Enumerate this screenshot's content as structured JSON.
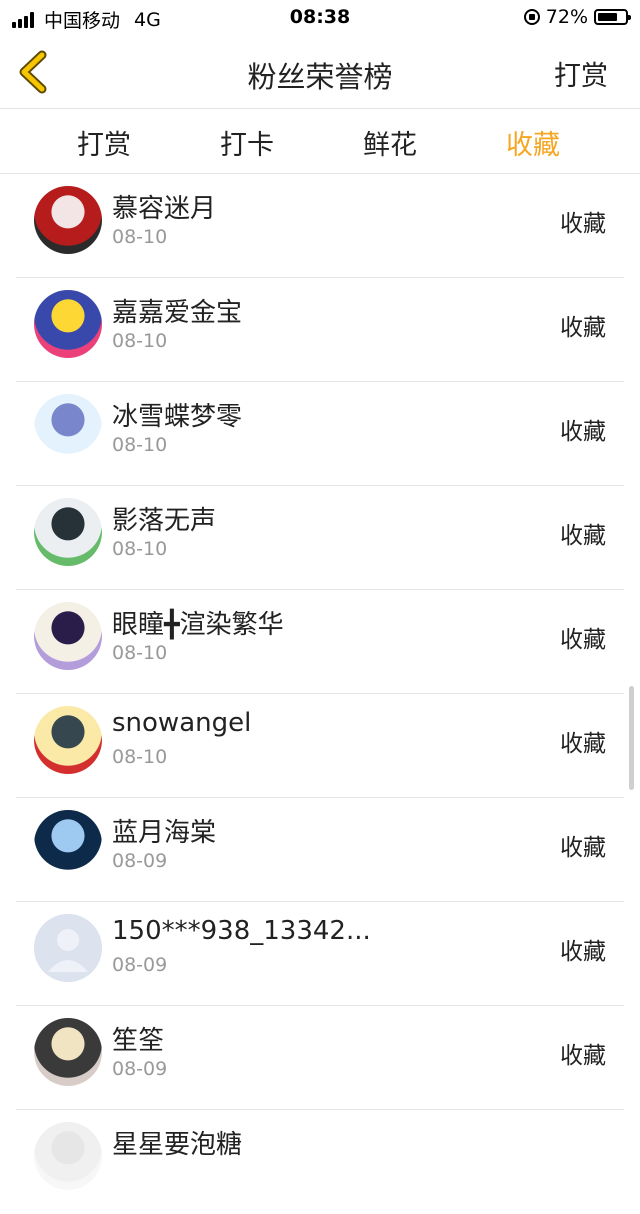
{
  "status_bar": {
    "carrier": "中国移动",
    "network": "4G",
    "time": "08:38",
    "battery_percent": "72%",
    "battery_level": 0.72
  },
  "nav": {
    "title": "粉丝荣誉榜",
    "right_action": "打赏"
  },
  "tabs": [
    {
      "label": "打赏",
      "active": false
    },
    {
      "label": "打卡",
      "active": false
    },
    {
      "label": "鲜花",
      "active": false
    },
    {
      "label": "收藏",
      "active": true
    }
  ],
  "colors": {
    "accent": "#f5a623",
    "text": "#222222",
    "secondary_text": "#999999",
    "divider": "#e6e6e6"
  },
  "list": [
    {
      "name": "慕容迷月",
      "date": "08-10",
      "action": "收藏",
      "avatar_colors": [
        "#b71c1c",
        "#f3e5e5",
        "#2b2b2b"
      ]
    },
    {
      "name": "嘉嘉爱金宝",
      "date": "08-10",
      "action": "收藏",
      "avatar_colors": [
        "#3949ab",
        "#fdd835",
        "#ec407a"
      ]
    },
    {
      "name": "冰雪蝶梦零",
      "date": "08-10",
      "action": "收藏",
      "avatar_colors": [
        "#e3f2fd",
        "#7986cb",
        "#ffffff"
      ]
    },
    {
      "name": "影落无声",
      "date": "08-10",
      "action": "收藏",
      "avatar_colors": [
        "#eceff1",
        "#263238",
        "#66bb6a"
      ]
    },
    {
      "name": "眼瞳╋渲染繁华",
      "date": "08-10",
      "action": "收藏",
      "avatar_colors": [
        "#f5f0e6",
        "#2a1d4a",
        "#b39ddb"
      ]
    },
    {
      "name": "snowangel",
      "date": "08-10",
      "action": "收藏",
      "avatar_colors": [
        "#fbe9a7",
        "#37474f",
        "#d32f2f"
      ]
    },
    {
      "name": "蓝月海棠",
      "date": "08-09",
      "action": "收藏",
      "avatar_colors": [
        "#0d2a4a",
        "#9ec9f0",
        "#ffffff"
      ]
    },
    {
      "name": "150***938_13342...",
      "date": "08-09",
      "action": "收藏",
      "avatar_colors": [
        "#dde3ee",
        "#f0f3f8",
        "#dde3ee"
      ]
    },
    {
      "name": "笙筌",
      "date": "08-09",
      "action": "收藏",
      "avatar_colors": [
        "#3a3a3a",
        "#f1e4c3",
        "#d7ccc8"
      ]
    },
    {
      "name": "星星要泡糖",
      "date": "",
      "action": "",
      "avatar_colors": [
        "#f0f0f0",
        "#e6e6e6",
        "#f7f7f7"
      ]
    }
  ]
}
